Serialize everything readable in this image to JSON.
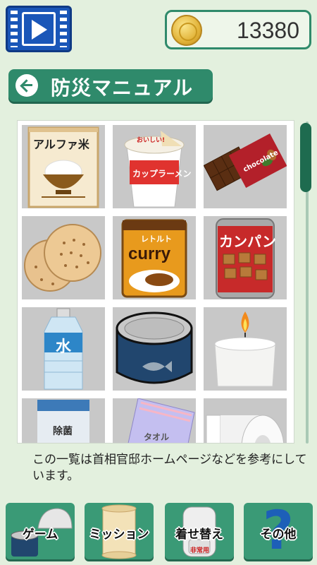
{
  "header": {
    "video_icon": "video-play-icon",
    "coin_icon": "gold-coin-icon",
    "coins": "13380"
  },
  "title": {
    "back_icon": "back-arrow-icon",
    "text": "防災マニュアル"
  },
  "items": [
    {
      "name": "alpha-rice",
      "label": "アルファ米",
      "sub": ""
    },
    {
      "name": "cup-ramen",
      "label": "カップラーメン",
      "sub": "おいしい!"
    },
    {
      "name": "chocolate",
      "label": "chocolate",
      "sub": ""
    },
    {
      "name": "crackers",
      "label": "",
      "sub": ""
    },
    {
      "name": "retort-curry",
      "label": "レトルト",
      "sub": "curry"
    },
    {
      "name": "kanpan",
      "label": "カンパン",
      "sub": ""
    },
    {
      "name": "water-bottle",
      "label": "水",
      "sub": ""
    },
    {
      "name": "canned-fish",
      "label": "",
      "sub": ""
    },
    {
      "name": "candle",
      "label": "",
      "sub": ""
    },
    {
      "name": "antibacterial-wipes",
      "label": "除菌",
      "sub": ""
    },
    {
      "name": "towel",
      "label": "タオル",
      "sub": ""
    },
    {
      "name": "toilet-paper",
      "label": "",
      "sub": ""
    }
  ],
  "note": "この一覧は首相官邸ホームページなどを参考にしています。",
  "nav": [
    {
      "label": "ゲーム",
      "icon": "helmet-can-icon"
    },
    {
      "label": "ミッション",
      "icon": "scroll-icon"
    },
    {
      "label": "着せ替え",
      "icon": "backpack-icon",
      "tag": "非常用"
    },
    {
      "label": "その他",
      "icon": "question-mark-icon"
    }
  ],
  "colors": {
    "accent": "#2f8a6b",
    "background": "#e3f0de",
    "cell": "#c8c8c8"
  }
}
